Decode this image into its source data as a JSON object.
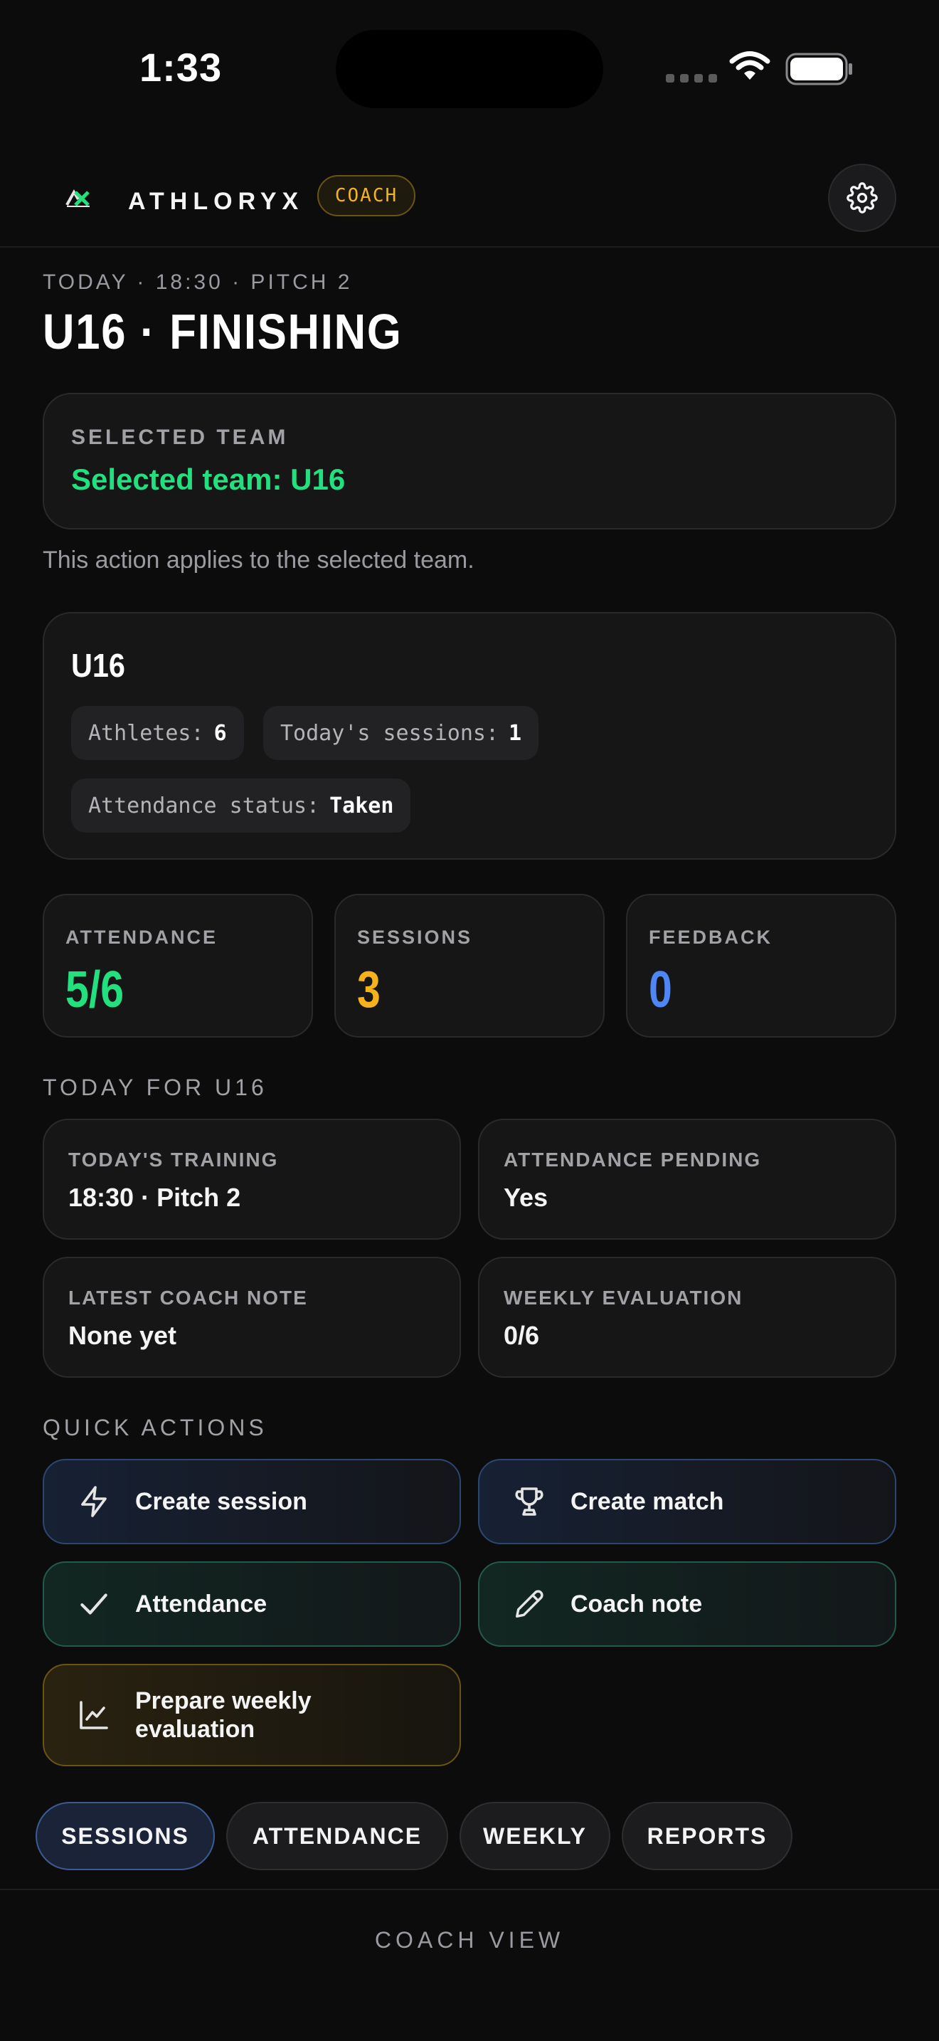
{
  "status_bar": {
    "time": "1:33"
  },
  "header": {
    "brand": "ATHLORYX",
    "role_badge": "COACH"
  },
  "page": {
    "subtitle": "TODAY · 18:30 · PITCH 2",
    "title": "U16 · FINISHING"
  },
  "team_selector": {
    "label": "SELECTED TEAM",
    "value": "Selected team: U16",
    "helper": "This action applies to the selected team."
  },
  "team_summary": {
    "name": "U16",
    "chips": [
      {
        "label": "Athletes:",
        "value": "6"
      },
      {
        "label": "Today's sessions:",
        "value": "1"
      },
      {
        "label": "Attendance status:",
        "value": "Taken"
      }
    ]
  },
  "stats": [
    {
      "label": "ATTENDANCE",
      "value": "5/6",
      "color": "#22e07e"
    },
    {
      "label": "SESSIONS",
      "value": "3",
      "color": "#f5b21b"
    },
    {
      "label": "FEEDBACK",
      "value": "0",
      "color": "#4f86f7"
    }
  ],
  "today_section": {
    "title": "TODAY FOR U16",
    "cards": [
      {
        "label": "TODAY'S TRAINING",
        "value": "18:30 · Pitch 2"
      },
      {
        "label": "ATTENDANCE PENDING",
        "value": "Yes"
      },
      {
        "label": "LATEST COACH NOTE",
        "value": "None yet"
      },
      {
        "label": "WEEKLY EVALUATION",
        "value": "0/6"
      }
    ]
  },
  "quick_actions": {
    "title": "QUICK ACTIONS",
    "items": [
      {
        "label": "Create session",
        "icon": "lightning-icon"
      },
      {
        "label": "Create match",
        "icon": "trophy-icon"
      },
      {
        "label": "Attendance",
        "icon": "check-icon"
      },
      {
        "label": "Coach note",
        "icon": "pencil-icon"
      },
      {
        "label": "Prepare weekly evaluation",
        "icon": "chart-line-icon"
      }
    ]
  },
  "tabs": [
    "SESSIONS",
    "ATTENDANCE",
    "WEEKLY",
    "REPORTS"
  ],
  "footer": {
    "label": "COACH VIEW"
  }
}
